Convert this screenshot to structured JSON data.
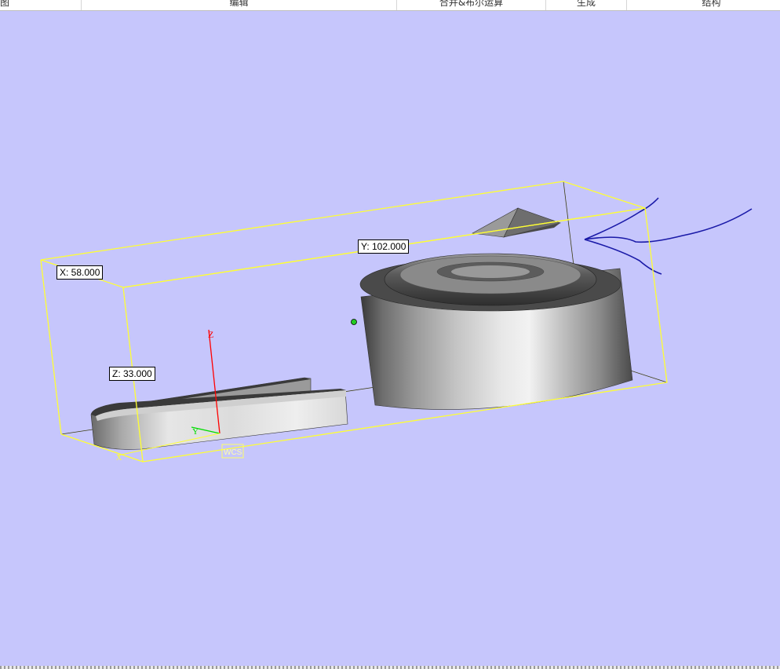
{
  "tabs": [
    {
      "label": "图"
    },
    {
      "label": "编辑"
    },
    {
      "label": "合并&布尔运算"
    },
    {
      "label": "生成"
    },
    {
      "label": "结构"
    }
  ],
  "dimensions": {
    "x": "X: 58.000",
    "y": "Y: 102.000",
    "z": "Z: 33.000"
  },
  "axes": {
    "z": "Z",
    "y": "Y",
    "x": "X"
  },
  "wcs_label": "WCS",
  "colors": {
    "background": "#c6c6fc",
    "bounding_box": "#ffff33",
    "curve": "#1a1aa8",
    "axis_z": "#ff0000",
    "axis_y": "#00dd00",
    "pivot": "#22cc22"
  }
}
